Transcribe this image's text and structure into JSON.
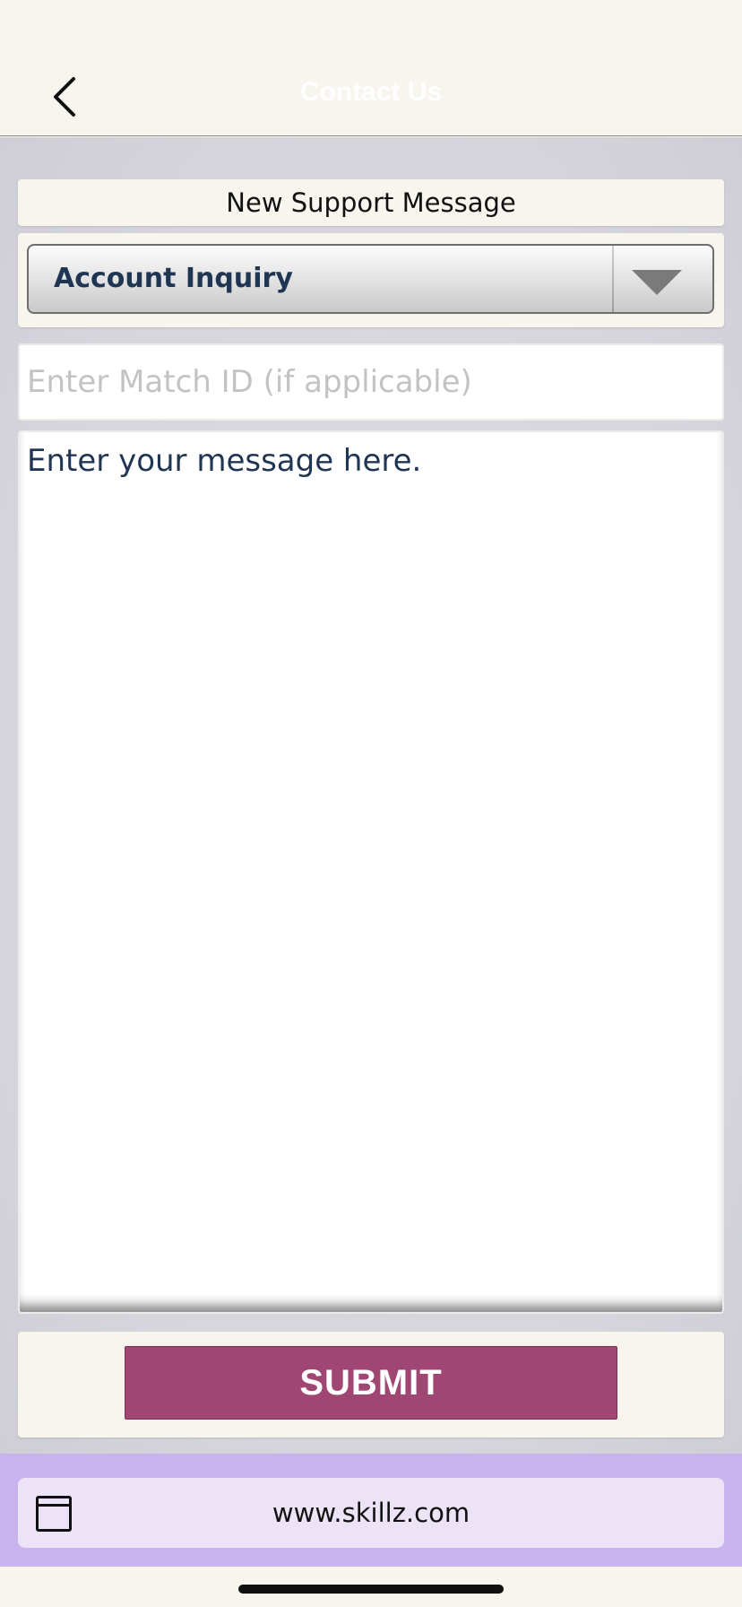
{
  "navbar": {
    "title": "Contact Us",
    "back_icon": "chevron-left-icon"
  },
  "form": {
    "header_title": "New Support Message",
    "category": {
      "selected": "Account Inquiry",
      "arrow_icon": "triangle-down-icon"
    },
    "match_id": {
      "value": "",
      "placeholder": "Enter Match ID (if applicable)"
    },
    "message": {
      "value": "",
      "placeholder": "Enter your message here."
    },
    "submit_label": "SUBMIT"
  },
  "footer": {
    "url": "www.skillz.com",
    "browser_icon": "browser-window-icon"
  },
  "colors": {
    "accent": "#9f4673",
    "text_dark": "#1f3552",
    "background": "#f8f5ef",
    "footer_purple": "#c9b3ef"
  }
}
